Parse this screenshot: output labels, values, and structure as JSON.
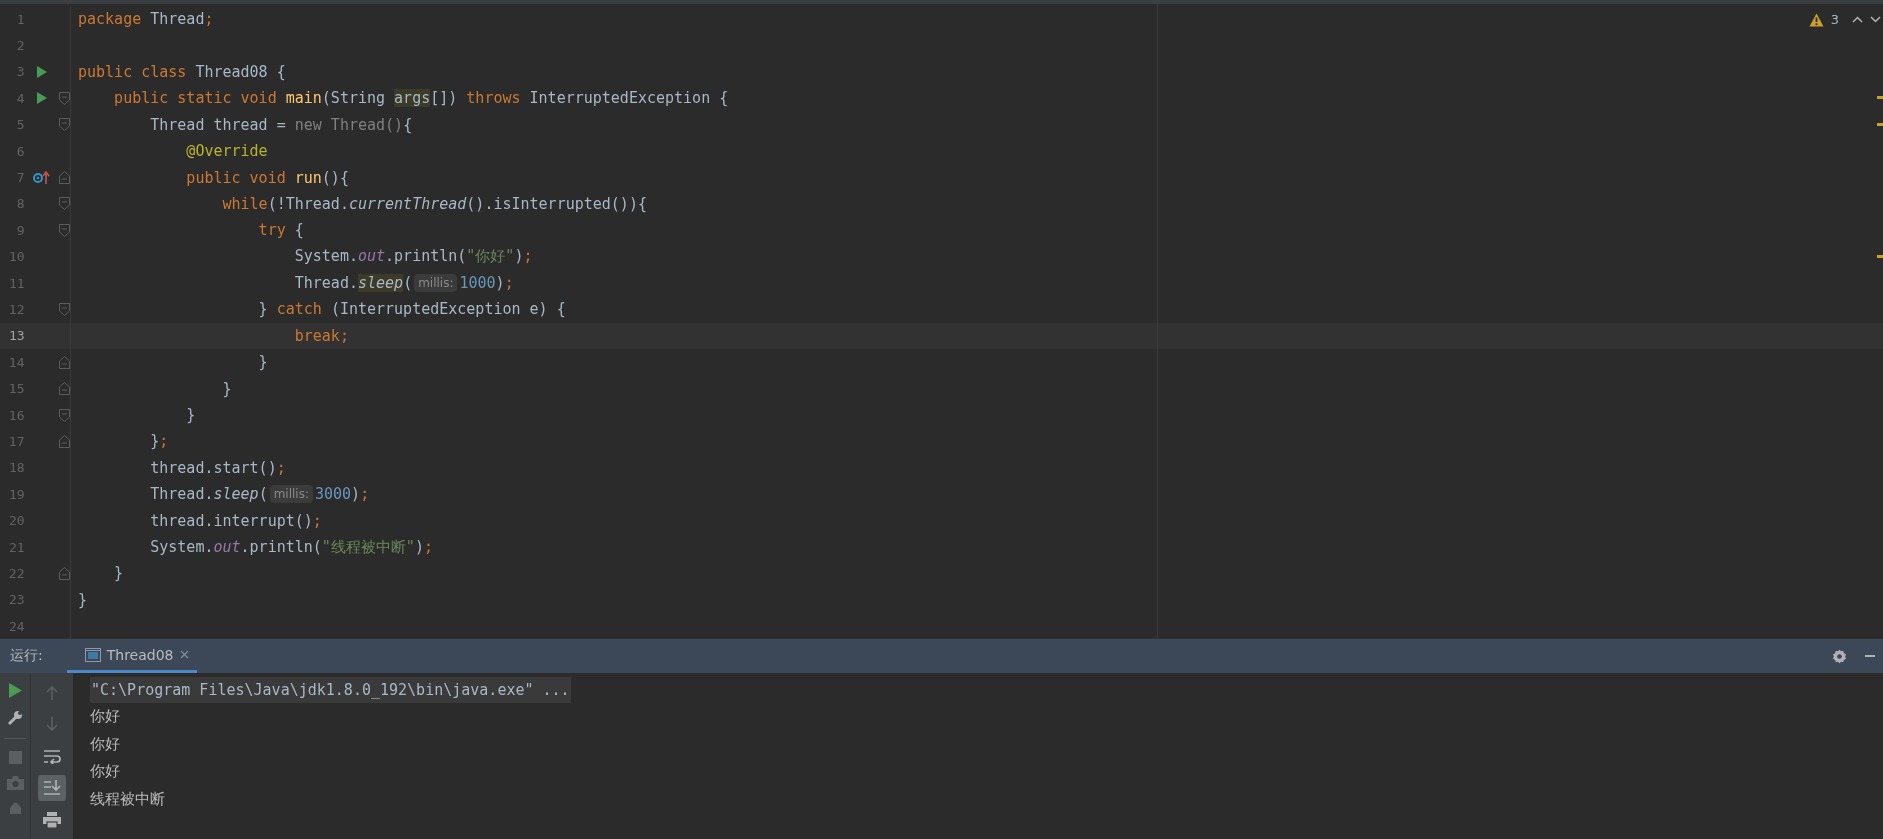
{
  "editor": {
    "warning_count": "3",
    "lines": [
      {
        "number": "1",
        "current": false,
        "warning": false,
        "tokens": [
          {
            "kind": "kw",
            "text": "package "
          },
          {
            "kind": "txt",
            "text": "Thread"
          },
          {
            "kind": "kw",
            "text": ";"
          }
        ]
      },
      {
        "number": "2",
        "current": false,
        "warning": false
      },
      {
        "number": "3",
        "gutter_icon": {
          "kind": "run"
        },
        "current": false,
        "warning": false,
        "tokens": [
          {
            "kind": "kw",
            "text": "public class "
          },
          {
            "kind": "txt",
            "text": "Thread08 {"
          }
        ]
      },
      {
        "number": "4",
        "gutter_icon": {
          "kind": "run"
        },
        "fold": {
          "kind": "open"
        },
        "current": false,
        "warning": true,
        "tokens": [
          {
            "kind": "kw",
            "text": "    public static void "
          },
          {
            "kind": "fn",
            "text": "main"
          },
          {
            "kind": "txt",
            "text": "(String "
          },
          {
            "kind": "hl",
            "text": "args"
          },
          {
            "kind": "txt",
            "text": "[]) "
          },
          {
            "kind": "kw",
            "text": "throws "
          },
          {
            "kind": "txt",
            "text": "InterruptedException {"
          }
        ]
      },
      {
        "number": "5",
        "fold": {
          "kind": "open"
        },
        "current": false,
        "warning": true,
        "tokens": [
          {
            "kind": "txt",
            "text": "        Thread thread = "
          },
          {
            "kind": "dim",
            "text": "new Thread()"
          },
          {
            "kind": "txt",
            "text": "{"
          }
        ]
      },
      {
        "number": "6",
        "current": false,
        "warning": false,
        "tokens": [
          {
            "kind": "ann",
            "text": "            @Override"
          }
        ]
      },
      {
        "number": "7",
        "gutter_icon": {
          "kind": "override"
        },
        "fold": {
          "kind": "close"
        },
        "current": false,
        "warning": false,
        "tokens": [
          {
            "kind": "kw",
            "text": "            public void "
          },
          {
            "kind": "fn",
            "text": "run"
          },
          {
            "kind": "txt",
            "text": "(){"
          }
        ]
      },
      {
        "number": "8",
        "fold": {
          "kind": "open"
        },
        "current": false,
        "warning": false,
        "tokens": [
          {
            "kind": "kw",
            "text": "                while"
          },
          {
            "kind": "txt",
            "text": "(!Thread."
          },
          {
            "kind": "it",
            "text": "currentThread"
          },
          {
            "kind": "txt",
            "text": "().isInterrupted()){"
          }
        ]
      },
      {
        "number": "9",
        "fold": {
          "kind": "open"
        },
        "current": false,
        "warning": false,
        "tokens": [
          {
            "kind": "kw",
            "text": "                    try "
          },
          {
            "kind": "txt",
            "text": "{"
          }
        ]
      },
      {
        "number": "10",
        "current": false,
        "warning": true,
        "tokens": [
          {
            "kind": "txt",
            "text": "                        System."
          },
          {
            "kind": "static",
            "text": "out"
          },
          {
            "kind": "txt",
            "text": ".println("
          },
          {
            "kind": "str",
            "text": "\"你好\""
          },
          {
            "kind": "txt",
            "text": ")"
          },
          {
            "kind": "kw",
            "text": ";"
          }
        ]
      },
      {
        "number": "11",
        "current": false,
        "warning": false,
        "tokens": [
          {
            "kind": "txt",
            "text": "                        Thread."
          },
          {
            "kind": "hlit",
            "text": "sleep"
          },
          {
            "kind": "txt",
            "text": "("
          },
          {
            "kind": "hint",
            "text": "millis:"
          },
          {
            "kind": "num",
            "text": "1000"
          },
          {
            "kind": "txt",
            "text": ")"
          },
          {
            "kind": "kw",
            "text": ";"
          }
        ]
      },
      {
        "number": "12",
        "fold": {
          "kind": "open"
        },
        "current": false,
        "warning": false,
        "tokens": [
          {
            "kind": "txt",
            "text": "                    } "
          },
          {
            "kind": "kw",
            "text": "catch "
          },
          {
            "kind": "txt",
            "text": "(InterruptedException e) {"
          }
        ]
      },
      {
        "number": "13",
        "current": true,
        "warning": false,
        "tokens": [
          {
            "kind": "kw",
            "text": "                        break;"
          }
        ]
      },
      {
        "number": "14",
        "fold": {
          "kind": "close"
        },
        "current": false,
        "warning": false,
        "tokens": [
          {
            "kind": "txt",
            "text": "                    }"
          }
        ]
      },
      {
        "number": "15",
        "fold": {
          "kind": "close"
        },
        "current": false,
        "warning": false,
        "tokens": [
          {
            "kind": "txt",
            "text": "                }"
          }
        ]
      },
      {
        "number": "16",
        "fold": {
          "kind": "open"
        },
        "current": false,
        "warning": false,
        "tokens": [
          {
            "kind": "txt",
            "text": "            }"
          }
        ]
      },
      {
        "number": "17",
        "fold": {
          "kind": "close"
        },
        "current": false,
        "warning": false,
        "tokens": [
          {
            "kind": "txt",
            "text": "        }"
          },
          {
            "kind": "kw",
            "text": ";"
          }
        ]
      },
      {
        "number": "18",
        "current": false,
        "warning": false,
        "tokens": [
          {
            "kind": "txt",
            "text": "        thread.start()"
          },
          {
            "kind": "kw",
            "text": ";"
          }
        ]
      },
      {
        "number": "19",
        "current": false,
        "warning": false,
        "tokens": [
          {
            "kind": "txt",
            "text": "        Thread."
          },
          {
            "kind": "it",
            "text": "sleep"
          },
          {
            "kind": "txt",
            "text": "("
          },
          {
            "kind": "hint",
            "text": "millis:"
          },
          {
            "kind": "num",
            "text": "3000"
          },
          {
            "kind": "txt",
            "text": ")"
          },
          {
            "kind": "kw",
            "text": ";"
          }
        ]
      },
      {
        "number": "20",
        "current": false,
        "warning": false,
        "tokens": [
          {
            "kind": "txt",
            "text": "        thread.interrupt()"
          },
          {
            "kind": "kw",
            "text": ";"
          }
        ]
      },
      {
        "number": "21",
        "current": false,
        "warning": false,
        "tokens": [
          {
            "kind": "txt",
            "text": "        System."
          },
          {
            "kind": "static",
            "text": "out"
          },
          {
            "kind": "txt",
            "text": ".println("
          },
          {
            "kind": "str",
            "text": "\"线程被中断\""
          },
          {
            "kind": "txt",
            "text": ")"
          },
          {
            "kind": "kw",
            "text": ";"
          }
        ]
      },
      {
        "number": "22",
        "fold": {
          "kind": "close"
        },
        "current": false,
        "warning": false,
        "tokens": [
          {
            "kind": "txt",
            "text": "    }"
          }
        ]
      },
      {
        "number": "23",
        "current": false,
        "warning": false,
        "tokens": [
          {
            "kind": "txt",
            "text": "}"
          }
        ]
      },
      {
        "number": "24",
        "current": false,
        "warning": false
      }
    ]
  },
  "run_panel": {
    "label": "运行:",
    "tabs": [
      {
        "title": "Thread08",
        "selected": true
      }
    ],
    "toolbar_left": [
      {
        "kind": "run",
        "disabled": false
      },
      {
        "kind": "wrench",
        "disabled": false
      },
      {
        "kind": "stop",
        "disabled": true
      },
      {
        "kind": "camera",
        "disabled": true
      },
      {
        "kind": "bug",
        "disabled": true
      }
    ],
    "toolbar_right": [
      {
        "kind": "up",
        "selected": false,
        "disabled": true
      },
      {
        "kind": "down",
        "selected": false,
        "disabled": true
      },
      {
        "kind": "wrap",
        "selected": false,
        "disabled": false
      },
      {
        "kind": "scroll-end",
        "selected": true,
        "disabled": false
      },
      {
        "kind": "print",
        "selected": false,
        "disabled": false
      }
    ],
    "console": [
      {
        "kind": "command",
        "text": "\"C:\\Program Files\\Java\\jdk1.8.0_192\\bin\\java.exe\" ..."
      },
      {
        "kind": "output",
        "text": "你好"
      },
      {
        "kind": "output",
        "text": "你好"
      },
      {
        "kind": "output",
        "text": "你好"
      },
      {
        "kind": "output",
        "text": "线程被中断"
      }
    ]
  }
}
